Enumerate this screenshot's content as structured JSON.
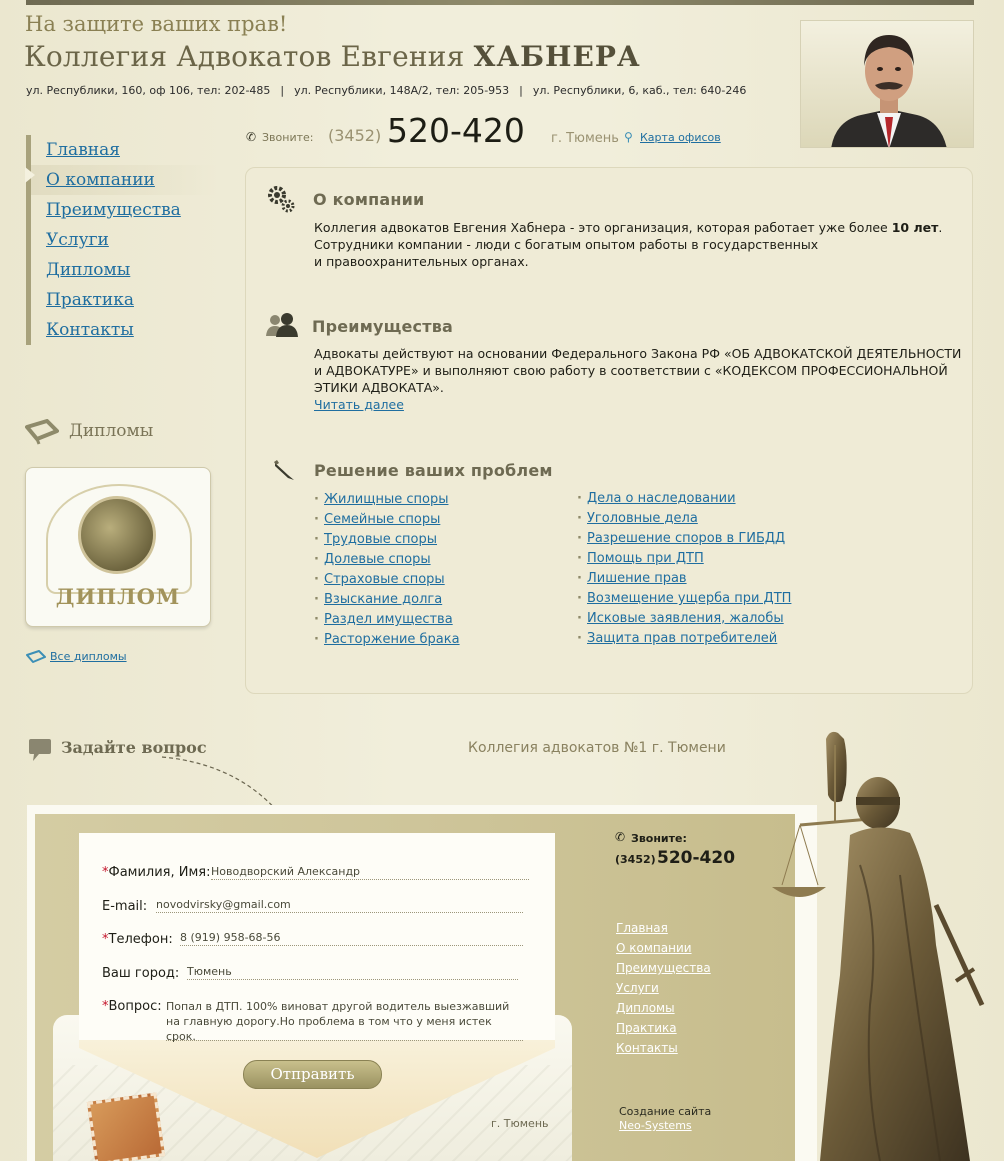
{
  "header": {
    "slogan": "На защите ваших прав!",
    "firm_prefix": "Коллегия Адвокатов Евгения",
    "firm_surname": "ХАБНЕРА",
    "addresses": [
      "ул. Республики, 160, оф 106, тел: 202-485",
      "ул. Республики, 148А/2, тел:  205-953",
      "ул. Республики, 6, каб., тел: 640-246"
    ],
    "separator": "|"
  },
  "phone": {
    "call_label": "Звоните:",
    "code": "(3452)",
    "number": "520-420",
    "city": "г. Тюмень",
    "map_link": "Карта офисов"
  },
  "nav": {
    "items": [
      {
        "label": "Главная"
      },
      {
        "label": "О компании"
      },
      {
        "label": "Преимущества"
      },
      {
        "label": "Услуги"
      },
      {
        "label": "Дипломы"
      },
      {
        "label": "Практика"
      },
      {
        "label": "Контакты"
      }
    ],
    "active_index": 1
  },
  "diplomas": {
    "title": "Дипломы",
    "card_text": "ДИПЛОМ",
    "all_link": "Все дипломы"
  },
  "about": {
    "title": "О компании",
    "text_1": "Коллегия адвокатов Евгения Хабнера - это организация, которая работает уже более",
    "text_bold": "10 лет",
    "text_2": ".",
    "text_3": "Сотрудники компании - люди с богатым опытом работы в государственных",
    "text_4": "и правоохранительных органах."
  },
  "advantages": {
    "title": "Преимущества",
    "line_1": "Адвокаты действуют на основании Федерального Закона РФ «ОБ АДВОКАТСКОЙ ДЕЯТЕЛЬНОСТИ",
    "line_2": "и АДВОКАТУРЕ» и выполняют свою работу в соответствии с «КОДЕКСОМ ПРОФЕССИОНАЛЬНОЙ",
    "line_3": "ЭТИКИ АДВОКАТА».",
    "read_more": "Читать далее"
  },
  "problems": {
    "title": "Решение ваших проблем",
    "left": [
      "Жилищные споры ",
      "Семейные споры",
      "Трудовые споры",
      "Долевые споры",
      "Страховые споры",
      "Взыскание долга",
      "Раздел имущества",
      "Расторжение брака"
    ],
    "right": [
      "Дела о наследовании",
      "Уголовные дела",
      "Разрешение споров в ГИБДД",
      "Помощь при ДТП",
      "Лишение прав",
      "Возмещение ущерба при ДТП",
      "Исковые заявления, жалобы",
      "Защита прав потребителей"
    ]
  },
  "ask": {
    "title": "Задайте вопрос",
    "slogan": "Коллегия адвокатов №1 г. Тюмени"
  },
  "form": {
    "required_mark": "*",
    "name_label": "Фамилия, Имя:",
    "name_value": "Новодворский Александр",
    "email_label": "E-mail:",
    "email_value": "novodvirsky@gmail.com",
    "phone_label": "Телефон:",
    "phone_value": "8 (919) 958-68-56",
    "city_label": "Ваш город:",
    "city_value": "Тюмень",
    "question_label": "Вопрос:",
    "question_line_1": "Попал в ДТП. 100% виноват другой водитель выезжавший",
    "question_line_2": "на главную дорогу.Но проблема в том что у меня истек срок.",
    "submit": "Отправить",
    "envelope_city": "г. Тюмень"
  },
  "footer": {
    "call_label": "Звоните:",
    "code": "(3452)",
    "number": "520-420",
    "nav": [
      {
        "label": "Главная"
      },
      {
        "label": "О компании"
      },
      {
        "label": "Преимущества"
      },
      {
        "label": "Услуги"
      },
      {
        "label": "Дипломы"
      },
      {
        "label": "Практика"
      },
      {
        "label": "Контакты"
      }
    ],
    "credits_label": "Создание сайта",
    "credits_link": "Neo-Systems"
  },
  "icons": {
    "phone": "phone-icon",
    "map_pin": "map-pin-icon",
    "gears": "gears-icon",
    "people": "people-icon",
    "pencil": "pencil-icon",
    "speech": "speech-bubble-icon",
    "diploma": "diploma-icon"
  },
  "colors": {
    "background": "#efebd6",
    "link": "#1f6ea0",
    "accent": "#a8a27c",
    "heading": "#6e6a52",
    "required": "#c4142a"
  }
}
